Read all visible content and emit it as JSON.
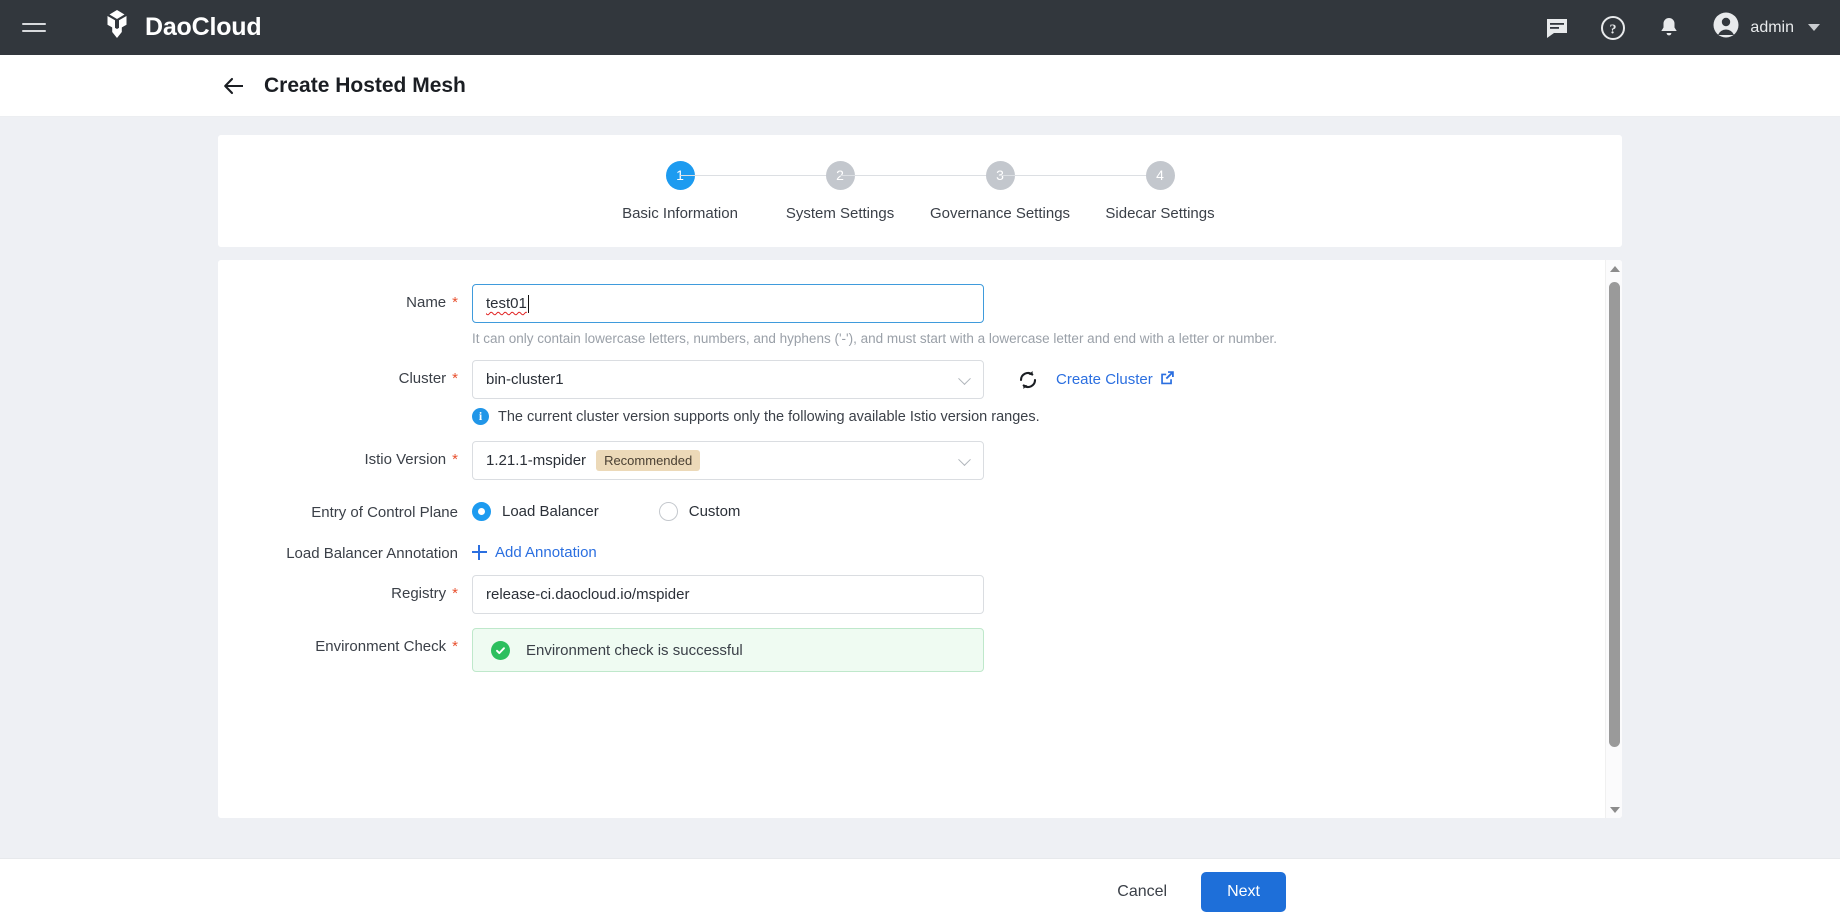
{
  "topnav": {
    "menu_icon": "hamburger-menu-icon",
    "brand_name": "DaoCloud",
    "logo_icon": "daocloud-cube-logo",
    "icons": [
      {
        "name": "chat-icon",
        "title": "Messages"
      },
      {
        "name": "help-icon",
        "title": "Help"
      },
      {
        "name": "bell-icon",
        "title": "Notifications"
      }
    ],
    "user": "admin",
    "user_avatar_icon": "user-avatar-icon",
    "caret_icon": "chevron-down-icon"
  },
  "header": {
    "back_icon": "arrow-left-icon",
    "title": "Create Hosted Mesh"
  },
  "stepper": {
    "steps": [
      {
        "number": "1",
        "label": "Basic Information",
        "state": "active"
      },
      {
        "number": "2",
        "label": "System Settings",
        "state": "inactive"
      },
      {
        "number": "3",
        "label": "Governance Settings",
        "state": "inactive"
      },
      {
        "number": "4",
        "label": "Sidecar Settings",
        "state": "inactive"
      }
    ],
    "active_color": "#1d9bf0",
    "inactive_color": "#c3c7cd"
  },
  "form": {
    "name": {
      "label": "Name",
      "required_mark": "*",
      "value": "test01",
      "placeholder": "",
      "hint": "It can only contain lowercase letters, numbers, and hyphens ('-'), and must start with a lowercase letter and end with a letter or number."
    },
    "cluster": {
      "label": "Cluster",
      "required_mark": "*",
      "value": "bin-cluster1",
      "refresh_icon": "refresh-icon",
      "create_link": "Create Cluster",
      "create_link_icon": "external-link-icon",
      "info_icon": "info-circle-icon",
      "info_text": "The current cluster version supports only the following available Istio version ranges."
    },
    "istio_version": {
      "label": "Istio Version",
      "required_mark": "*",
      "value": "1.21.1-mspider",
      "badge": "Recommended",
      "badge_color": "#ecd9b8"
    },
    "entry_control_plane": {
      "label": "Entry of Control Plane",
      "options": [
        {
          "label": "Load Balancer",
          "selected": true
        },
        {
          "label": "Custom",
          "selected": false
        }
      ]
    },
    "lb_annotation": {
      "label": "Load Balancer Annotation",
      "add_label": "Add Annotation",
      "add_icon": "plus-icon"
    },
    "registry": {
      "label": "Registry",
      "required_mark": "*",
      "value": "release-ci.daocloud.io/mspider",
      "placeholder": ""
    },
    "environment_check": {
      "label": "Environment Check",
      "required_mark": "*",
      "status_icon": "check-circle-icon",
      "status_text": "Environment check is successful",
      "status_color": "#2cbf5e"
    }
  },
  "footer": {
    "cancel_label": "Cancel",
    "next_label": "Next",
    "primary_color": "#1e6fd9"
  }
}
